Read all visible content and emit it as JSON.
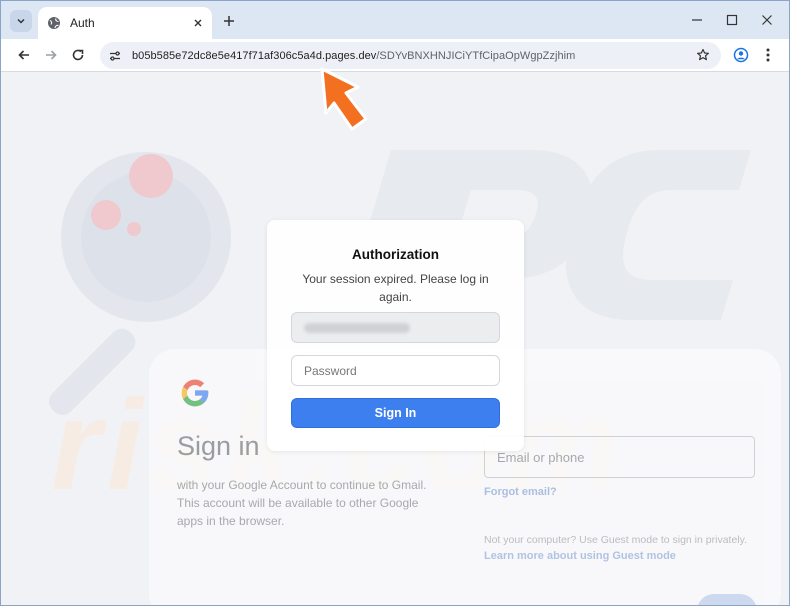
{
  "browser": {
    "tab": {
      "title": "Auth"
    },
    "address_bar": {
      "host": "b05b585e72dc8e5e417f71af306c5a4d.pages.dev",
      "path": "/SDYvBNXHNJICiYTfCipaOpWgpZzjhim"
    }
  },
  "auth_modal": {
    "title": "Authorization",
    "subtitle": "Your session expired. Please log in again.",
    "password_placeholder": "Password",
    "sign_in_label": "Sign In"
  },
  "google_card": {
    "title": "Sign in",
    "description": "with your Google Account to continue to Gmail. This account will be available to other Google apps in the browser.",
    "email_placeholder": "Email or phone",
    "forgot_email": "Forgot email?",
    "guest_text": "Not your computer? Use Guest mode to sign in privately.",
    "learn_more": "Learn more about using Guest mode"
  },
  "colors": {
    "accent": "#3e7ff0",
    "arrow": "#f37021"
  }
}
